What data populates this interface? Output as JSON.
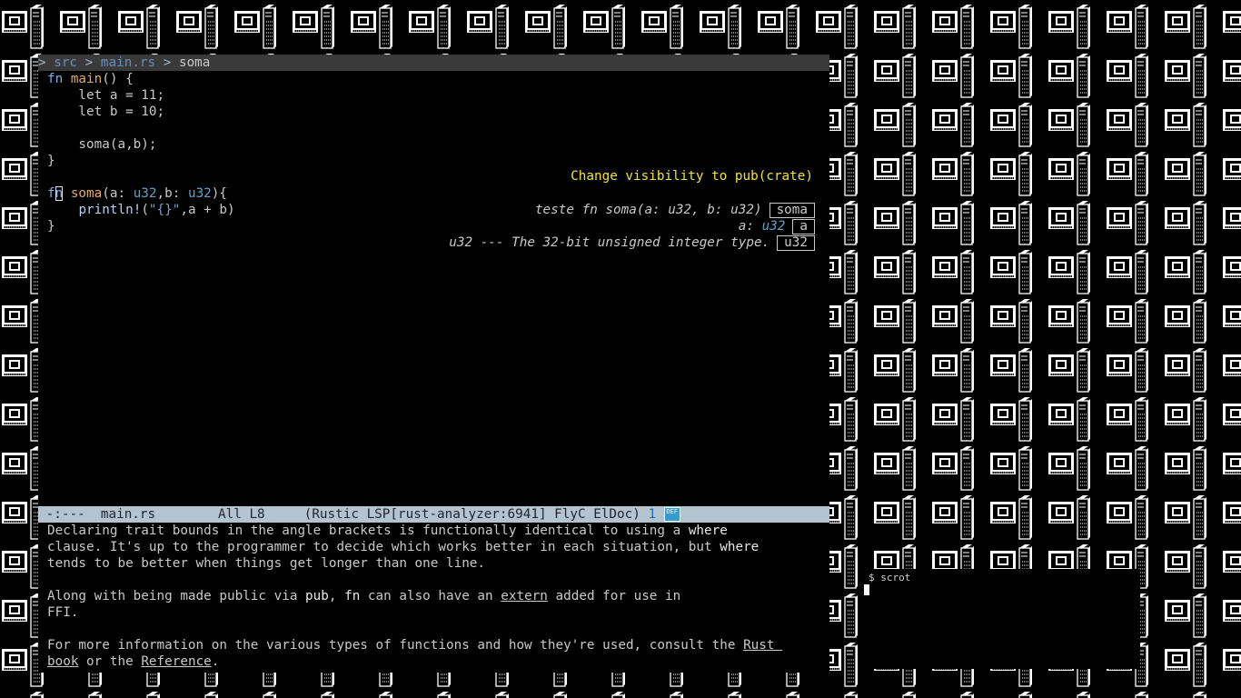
{
  "breadcrumb": {
    "prefix": "> ",
    "items": [
      "src",
      "main.rs",
      "soma"
    ],
    "separator": " > "
  },
  "code": {
    "l1_kw": "fn",
    "l1_fn": "main",
    "l1_rest": "() {",
    "l2": "    let a = 11;",
    "l3": "    let b = 10;",
    "l4": "",
    "l5": "    soma(a,b);",
    "l6": "}",
    "l7": "",
    "l8_kw_a": "f",
    "l8_kw_b": "n",
    "l8_fn": "soma",
    "l8_p1": "(a: ",
    "l8_t1": "u32",
    "l8_p2": ",b: ",
    "l8_t2": "u32",
    "l8_p3": "){",
    "l9_ind": "    ",
    "l9_mac": "println!",
    "l9_p1": "(",
    "l9_str": "\"{}\"",
    "l9_p2": ",a + b)",
    "l10": "}"
  },
  "lsp": {
    "code_action": "Change visibility to pub(crate)",
    "doc1_text": "teste fn soma(a: u32, b: u32)",
    "doc1_box": "soma",
    "doc2_label": "a: ",
    "doc2_type": "u32",
    "doc2_box": "a",
    "doc3_text": "u32 --- The 32-bit unsigned integer type.",
    "doc3_box": "u32"
  },
  "modeline": {
    "status": "-:---",
    "buffer": "main.rs",
    "position": "All L8",
    "modes": "(Rustic LSP[rust-analyzer:6941] FlyC ElDoc)",
    "count": "1",
    "badge": "DEF"
  },
  "doc_pane": {
    "p1_l1_a": "Declaring trait bounds in the angle brackets is functionally identical to using a ",
    "p1_l1_kw": "where",
    "p1_l2_a": "clause. It's up to the programmer to decide which works better in each situation, but ",
    "p1_l2_kw": "where",
    "p1_l3": "tends to be better when things get longer than one line.",
    "p2_l1_a": "Along with being made public via ",
    "p2_l1_kw1": "pub",
    "p2_l1_b": ", ",
    "p2_l1_kw2": "fn",
    "p2_l1_c": " can also have an ",
    "p2_l1_link": "extern",
    "p2_l1_d": " added for use in",
    "p2_l2": "FFI.",
    "p3_l1_a": "For more information on the various types of functions and how they're used, consult the ",
    "p3_l1_link": "Rust ",
    "p3_l2_link1": "book",
    "p3_l2_a": " or the ",
    "p3_l2_link2": "Reference",
    "p3_l2_b": "."
  },
  "terminal": {
    "prompt_line": "$ scrot"
  },
  "colors": {
    "keyword": "#7fb1e3",
    "function": "#e2a86a",
    "type": "#5fa3c8",
    "code_action": "#f2e33a",
    "modeline_bg": "#b3c3cf"
  }
}
